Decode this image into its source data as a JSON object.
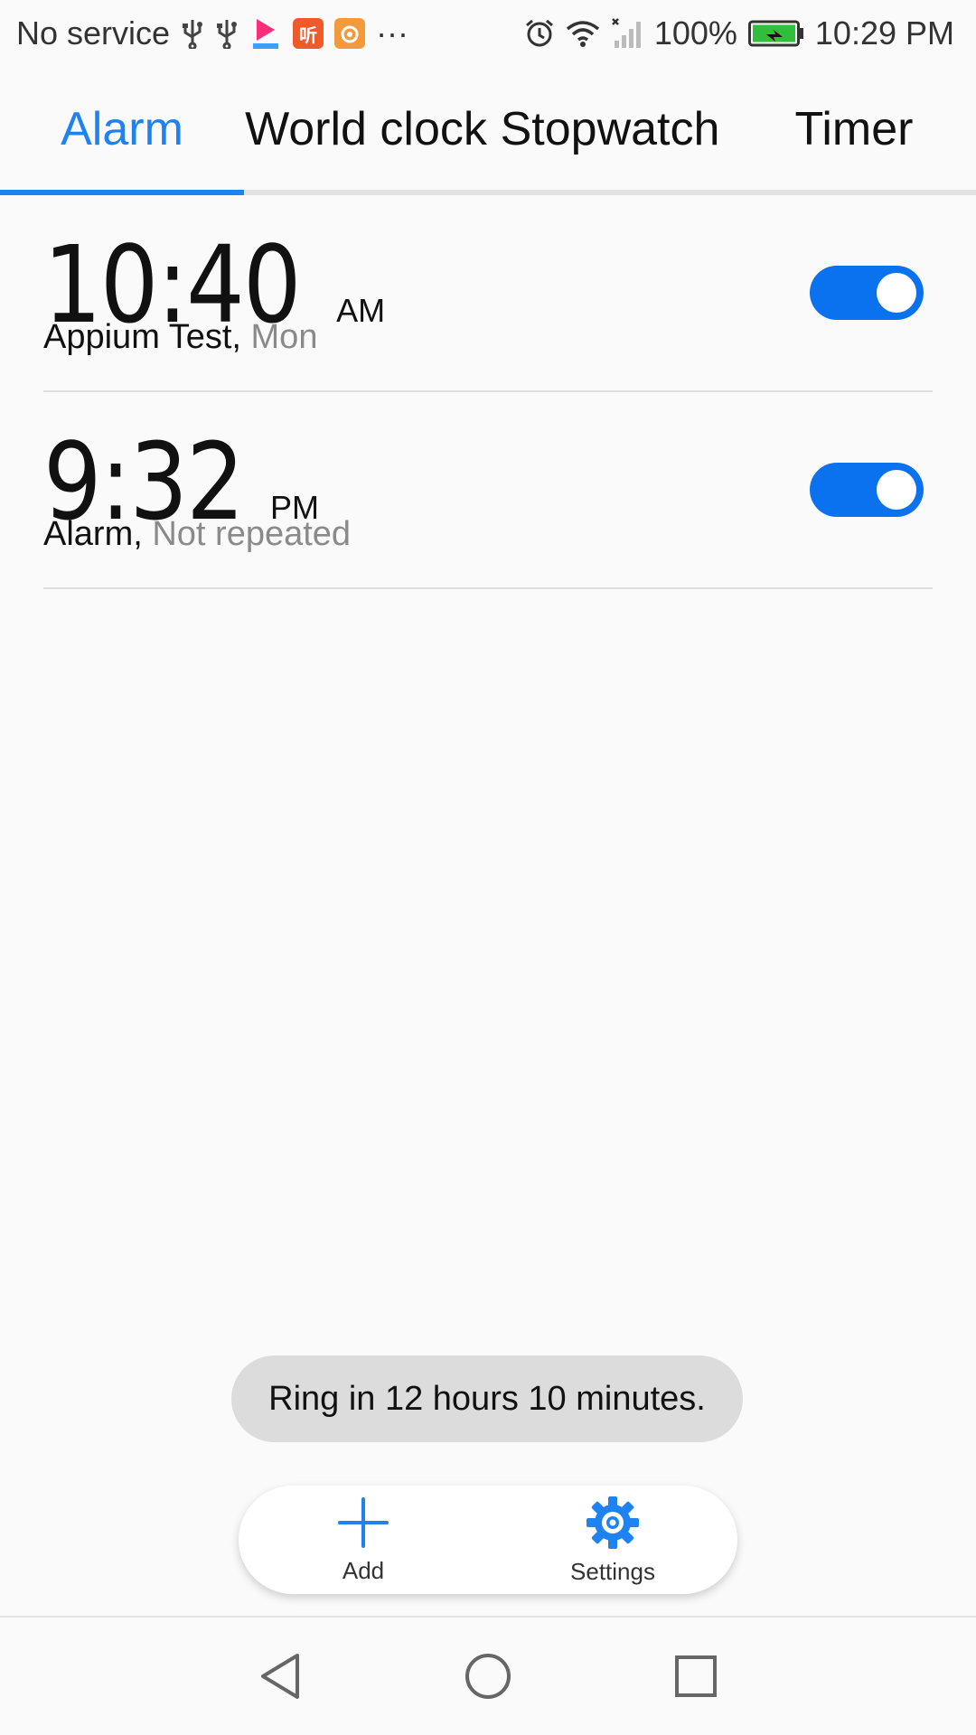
{
  "status_bar": {
    "carrier": "No service",
    "battery_percent": "100%",
    "time": "10:29 PM",
    "overflow": "···",
    "app_badge_ting": "听",
    "icons": [
      "usb-icon",
      "usb-icon",
      "youku-icon",
      "ting-app-icon",
      "uc-browser-icon",
      "alarm-clock-icon",
      "wifi-icon",
      "signal-icon",
      "battery-charging-icon"
    ],
    "colors": {
      "battery_fill": "#2fbf3a"
    }
  },
  "tabs": [
    {
      "label": "Alarm",
      "active": true
    },
    {
      "label": "World clock",
      "active": false
    },
    {
      "label": "Stopwatch",
      "active": false
    },
    {
      "label": "Timer",
      "active": false
    }
  ],
  "alarms": [
    {
      "time": "10:40",
      "ampm": "AM",
      "label": "Appium Test,",
      "repeat": "Mon",
      "enabled": true
    },
    {
      "time": "9:32",
      "ampm": "PM",
      "label": "Alarm,",
      "repeat": "Not repeated",
      "enabled": true
    }
  ],
  "toast": "Ring in 12 hours 10 minutes.",
  "actions": {
    "add_label": "Add",
    "settings_label": "Settings"
  },
  "nav": [
    "back-icon",
    "home-icon",
    "recents-icon"
  ],
  "colors": {
    "accent": "#1e82f0",
    "toggle_on": "#0a72ee"
  }
}
